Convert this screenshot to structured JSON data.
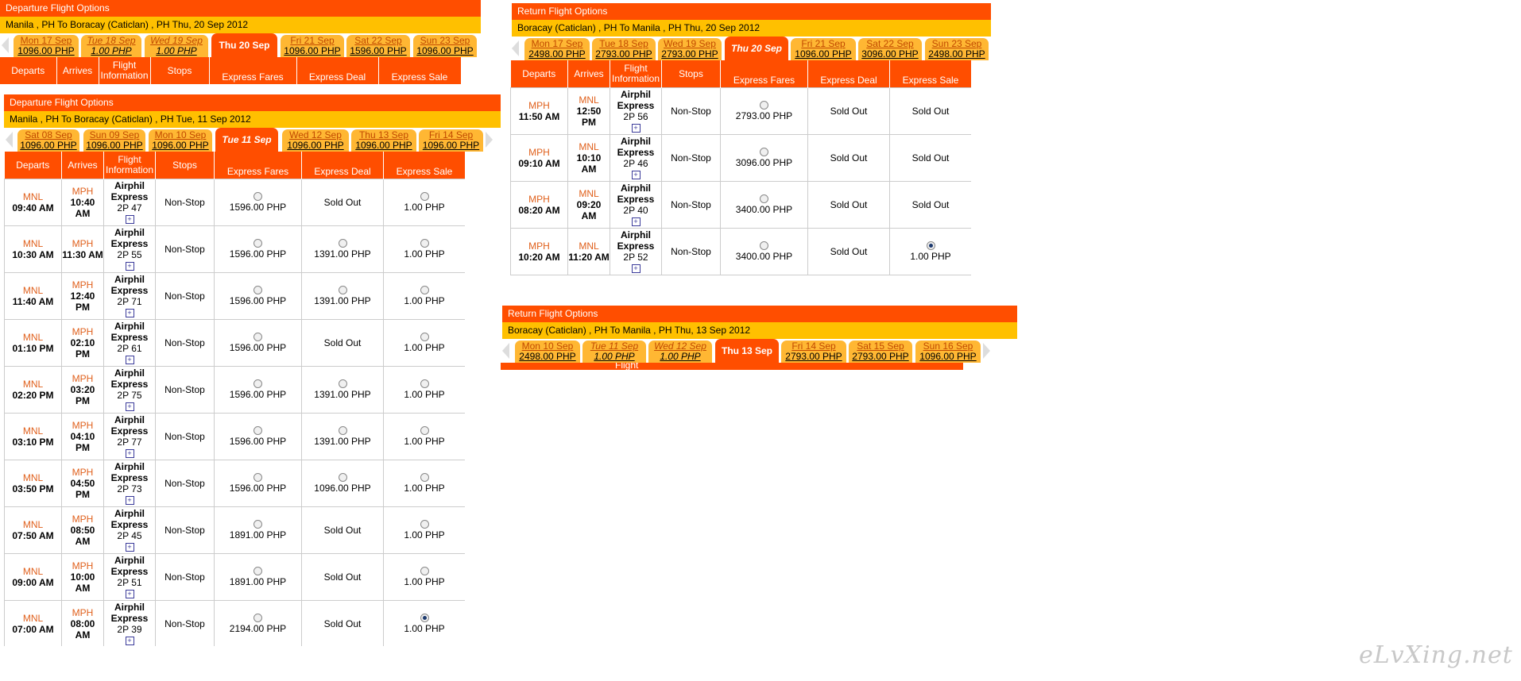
{
  "panel_a": {
    "title": "Departure Flight Options",
    "route": "Manila , PH To Boracay (Caticlan) , PH Thu, 20 Sep 2012",
    "tabs": [
      {
        "day": "Mon 17 Sep",
        "price": "1096.00 PHP"
      },
      {
        "day": "Tue 18 Sep",
        "price": "1.00 PHP"
      },
      {
        "day": "Wed 19 Sep",
        "price": "1.00 PHP"
      },
      {
        "day": "Thu 20 Sep",
        "price": ""
      },
      {
        "day": "Fri 21 Sep",
        "price": "1096.00 PHP"
      },
      {
        "day": "Sat 22 Sep",
        "price": "1596.00 PHP"
      },
      {
        "day": "Sun 23 Sep",
        "price": "1096.00 PHP"
      }
    ],
    "headers": {
      "departs": "Departs",
      "arrives": "Arrives",
      "flight_info": "Flight Information",
      "stops": "Stops",
      "express_fares": "Express Fares",
      "express_deal": "Express Deal",
      "express_sale": "Express Sale"
    }
  },
  "panel_b": {
    "title": "Departure Flight Options",
    "route": "Manila , PH To Boracay (Caticlan) , PH Tue, 11 Sep 2012",
    "tabs": [
      {
        "day": "Sat 08 Sep",
        "price": "1096.00 PHP"
      },
      {
        "day": "Sun 09 Sep",
        "price": "1096.00 PHP"
      },
      {
        "day": "Mon 10 Sep",
        "price": "1096.00 PHP"
      },
      {
        "day": "Tue 11 Sep",
        "price": ""
      },
      {
        "day": "Wed 12 Sep",
        "price": "1096.00 PHP"
      },
      {
        "day": "Thu 13 Sep",
        "price": "1096.00 PHP"
      },
      {
        "day": "Fri 14 Sep",
        "price": "1096.00 PHP"
      }
    ],
    "headers": {
      "departs": "Departs",
      "arrives": "Arrives",
      "flight_info": "Flight Information",
      "stops": "Stops",
      "express_fares": "Express Fares",
      "express_deal": "Express Deal",
      "express_sale": "Express Sale"
    },
    "rows": [
      {
        "dep_code": "MNL",
        "dep_time": "09:40 AM",
        "arr_code": "MPH",
        "arr_time": "10:40 AM",
        "airline": "Airphil Express",
        "flight": "2P 47",
        "stops": "Non-Stop",
        "fare": "1596.00 PHP",
        "deal": "Sold Out",
        "sale": "1.00 PHP",
        "selected": false
      },
      {
        "dep_code": "MNL",
        "dep_time": "10:30 AM",
        "arr_code": "MPH",
        "arr_time": "11:30 AM",
        "airline": "Airphil Express",
        "flight": "2P 55",
        "stops": "Non-Stop",
        "fare": "1596.00 PHP",
        "deal": "1391.00 PHP",
        "sale": "1.00 PHP",
        "selected": false
      },
      {
        "dep_code": "MNL",
        "dep_time": "11:40 AM",
        "arr_code": "MPH",
        "arr_time": "12:40 PM",
        "airline": "Airphil Express",
        "flight": "2P 71",
        "stops": "Non-Stop",
        "fare": "1596.00 PHP",
        "deal": "1391.00 PHP",
        "sale": "1.00 PHP",
        "selected": false
      },
      {
        "dep_code": "MNL",
        "dep_time": "01:10 PM",
        "arr_code": "MPH",
        "arr_time": "02:10 PM",
        "airline": "Airphil Express",
        "flight": "2P 61",
        "stops": "Non-Stop",
        "fare": "1596.00 PHP",
        "deal": "Sold Out",
        "sale": "1.00 PHP",
        "selected": false
      },
      {
        "dep_code": "MNL",
        "dep_time": "02:20 PM",
        "arr_code": "MPH",
        "arr_time": "03:20 PM",
        "airline": "Airphil Express",
        "flight": "2P 75",
        "stops": "Non-Stop",
        "fare": "1596.00 PHP",
        "deal": "1391.00 PHP",
        "sale": "1.00 PHP",
        "selected": false
      },
      {
        "dep_code": "MNL",
        "dep_time": "03:10 PM",
        "arr_code": "MPH",
        "arr_time": "04:10 PM",
        "airline": "Airphil Express",
        "flight": "2P 77",
        "stops": "Non-Stop",
        "fare": "1596.00 PHP",
        "deal": "1391.00 PHP",
        "sale": "1.00 PHP",
        "selected": false
      },
      {
        "dep_code": "MNL",
        "dep_time": "03:50 PM",
        "arr_code": "MPH",
        "arr_time": "04:50 PM",
        "airline": "Airphil Express",
        "flight": "2P 73",
        "stops": "Non-Stop",
        "fare": "1596.00 PHP",
        "deal": "1096.00 PHP",
        "sale": "1.00 PHP",
        "selected": false
      },
      {
        "dep_code": "MNL",
        "dep_time": "07:50 AM",
        "arr_code": "MPH",
        "arr_time": "08:50 AM",
        "airline": "Airphil Express",
        "flight": "2P 45",
        "stops": "Non-Stop",
        "fare": "1891.00 PHP",
        "deal": "Sold Out",
        "sale": "1.00 PHP",
        "selected": false
      },
      {
        "dep_code": "MNL",
        "dep_time": "09:00 AM",
        "arr_code": "MPH",
        "arr_time": "10:00 AM",
        "airline": "Airphil Express",
        "flight": "2P 51",
        "stops": "Non-Stop",
        "fare": "1891.00 PHP",
        "deal": "Sold Out",
        "sale": "1.00 PHP",
        "selected": false
      },
      {
        "dep_code": "MNL",
        "dep_time": "07:00 AM",
        "arr_code": "MPH",
        "arr_time": "08:00 AM",
        "airline": "Airphil Express",
        "flight": "2P 39",
        "stops": "Non-Stop",
        "fare": "2194.00 PHP",
        "deal": "Sold Out",
        "sale": "1.00 PHP",
        "selected": true
      }
    ]
  },
  "panel_c": {
    "title": "Return Flight Options",
    "route": "Boracay (Caticlan) , PH To Manila , PH Thu, 20 Sep 2012",
    "tabs": [
      {
        "day": "Mon 17 Sep",
        "price": "2498.00 PHP"
      },
      {
        "day": "Tue 18 Sep",
        "price": "2793.00 PHP"
      },
      {
        "day": "Wed 19 Sep",
        "price": "2793.00 PHP"
      },
      {
        "day": "Thu 20 Sep",
        "price": ""
      },
      {
        "day": "Fri 21 Sep",
        "price": "1096.00 PHP"
      },
      {
        "day": "Sat 22 Sep",
        "price": "3096.00 PHP"
      },
      {
        "day": "Sun 23 Sep",
        "price": "2498.00 PHP"
      }
    ],
    "headers": {
      "departs": "Departs",
      "arrives": "Arrives",
      "flight_info": "Flight Information",
      "stops": "Stops",
      "express_fares": "Express Fares",
      "express_deal": "Express Deal",
      "express_sale": "Express Sale"
    },
    "rows": [
      {
        "dep_code": "MPH",
        "dep_time": "11:50 AM",
        "arr_code": "MNL",
        "arr_time": "12:50 PM",
        "airline": "Airphil Express",
        "flight": "2P 56",
        "stops": "Non-Stop",
        "fare": "2793.00 PHP",
        "deal": "Sold Out",
        "sale": "Sold Out",
        "selected": false
      },
      {
        "dep_code": "MPH",
        "dep_time": "09:10 AM",
        "arr_code": "MNL",
        "arr_time": "10:10 AM",
        "airline": "Airphil Express",
        "flight": "2P 46",
        "stops": "Non-Stop",
        "fare": "3096.00 PHP",
        "deal": "Sold Out",
        "sale": "Sold Out",
        "selected": false
      },
      {
        "dep_code": "MPH",
        "dep_time": "08:20 AM",
        "arr_code": "MNL",
        "arr_time": "09:20 AM",
        "airline": "Airphil Express",
        "flight": "2P 40",
        "stops": "Non-Stop",
        "fare": "3400.00 PHP",
        "deal": "Sold Out",
        "sale": "Sold Out",
        "selected": false
      },
      {
        "dep_code": "MPH",
        "dep_time": "10:20 AM",
        "arr_code": "MNL",
        "arr_time": "11:20 AM",
        "airline": "Airphil Express",
        "flight": "2P 52",
        "stops": "Non-Stop",
        "fare": "3400.00 PHP",
        "deal": "Sold Out",
        "sale": "1.00 PHP",
        "selected": true
      }
    ]
  },
  "panel_d": {
    "title": "Return Flight Options",
    "route": "Boracay (Caticlan) , PH To Manila , PH Thu, 13 Sep 2012",
    "tabs": [
      {
        "day": "Mon 10 Sep",
        "price": "2498.00 PHP"
      },
      {
        "day": "Tue 11 Sep",
        "price": "1.00 PHP"
      },
      {
        "day": "Wed 12 Sep",
        "price": "1.00 PHP"
      },
      {
        "day": "Thu 13 Sep",
        "price": ""
      },
      {
        "day": "Fri 14 Sep",
        "price": "2793.00 PHP"
      },
      {
        "day": "Sat 15 Sep",
        "price": "2793.00 PHP"
      },
      {
        "day": "Sun 16 Sep",
        "price": "1096.00 PHP"
      }
    ],
    "partial_header": "Flight"
  },
  "watermark": "eLvXing.net",
  "colors": {
    "header_orange": "#ff4e00",
    "route_yellow": "#ffc000",
    "tab_yellow": "#ffb733",
    "code_orange": "#e0601c"
  }
}
